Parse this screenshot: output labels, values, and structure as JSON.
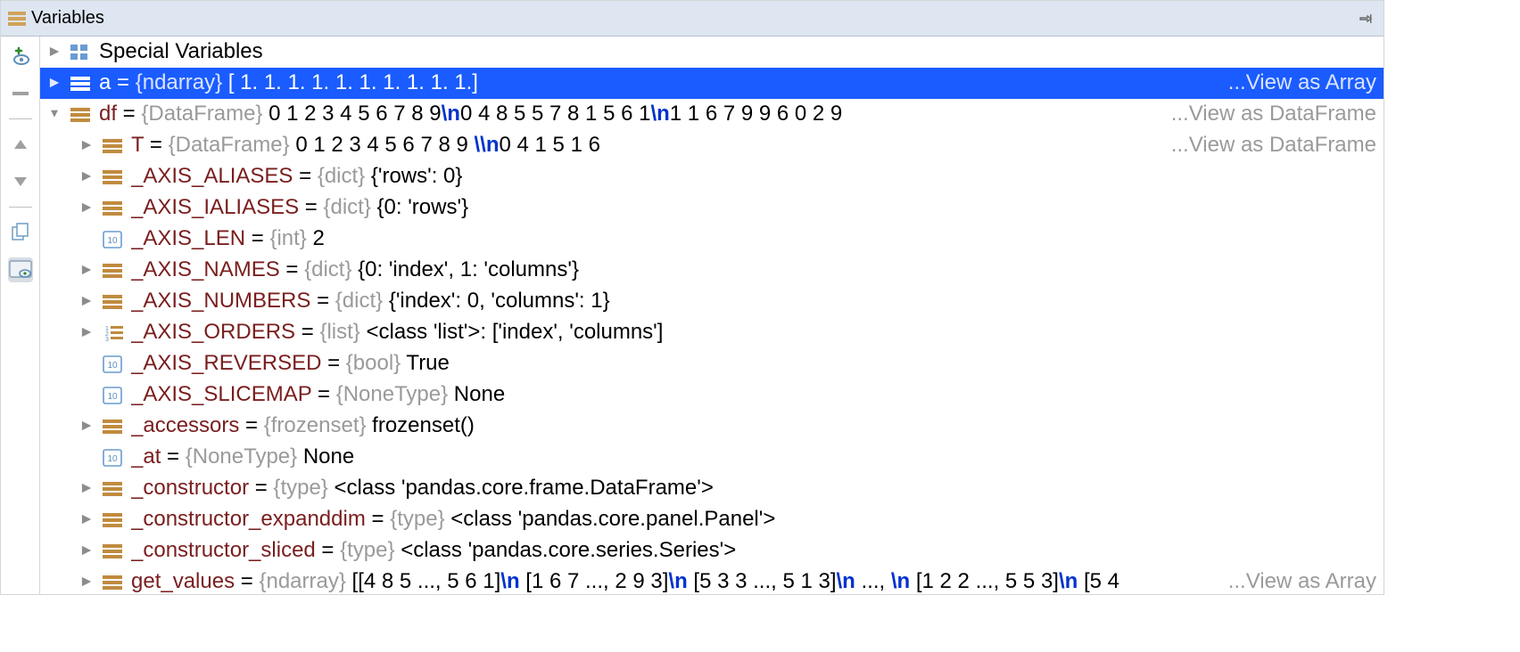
{
  "header": {
    "title": "Variables"
  },
  "colors": {
    "selected_bg": "#1a5cff",
    "name": "#7a1e1e",
    "type": "#9a9a9a",
    "esc": "#0033cc"
  },
  "rows": [
    {
      "indent": 0,
      "chevron": "closed",
      "icon": "grid",
      "name": "Special Variables",
      "eq": "",
      "type": "",
      "val": "",
      "link": ""
    },
    {
      "indent": 0,
      "chevron": "closed",
      "icon": "bars",
      "name": "a",
      "eq": " = ",
      "type": "{ndarray}",
      "val": " [ 1.  1.  1.  1.  1.  1.  1.  1.  1.  1.] ",
      "link": "...View as Array",
      "selected": true
    },
    {
      "indent": 0,
      "chevron": "open",
      "icon": "bars",
      "name": "df",
      "eq": " = ",
      "type": "{DataFrame}",
      "segments": [
        {
          "t": "   0  1  2  3  4  5  6  7  8  9"
        },
        {
          "t": "\\n",
          "esc": true
        },
        {
          "t": "0     4  8  5  5  7  8  1  5  6  1"
        },
        {
          "t": "\\n",
          "esc": true
        },
        {
          "t": "1     1  6  7  9  9  6  0  2  9"
        }
      ],
      "link": "...View as DataFrame"
    },
    {
      "indent": 1,
      "chevron": "closed",
      "icon": "bars",
      "name": "T",
      "eq": " = ",
      "type": "{DataFrame}",
      "segments": [
        {
          "t": "   0     1     2     3     4     5     6     7     8     9     "
        },
        {
          "t": "\\\\n",
          "esc": true
        },
        {
          "t": "0     4     1     5     1     6    "
        }
      ],
      "link": "...View as DataFrame"
    },
    {
      "indent": 1,
      "chevron": "closed",
      "icon": "bars",
      "name": "_AXIS_ALIASES",
      "eq": " = ",
      "type": "{dict}",
      "val": " {'rows': 0}"
    },
    {
      "indent": 1,
      "chevron": "closed",
      "icon": "bars",
      "name": "_AXIS_IALIASES",
      "eq": " = ",
      "type": "{dict}",
      "val": " {0: 'rows'}"
    },
    {
      "indent": 1,
      "chevron": "none",
      "icon": "binary",
      "name": "_AXIS_LEN",
      "eq": " = ",
      "type": "{int}",
      "val": " 2"
    },
    {
      "indent": 1,
      "chevron": "closed",
      "icon": "bars",
      "name": "_AXIS_NAMES",
      "eq": " = ",
      "type": "{dict}",
      "val": " {0: 'index', 1: 'columns'}"
    },
    {
      "indent": 1,
      "chevron": "closed",
      "icon": "bars",
      "name": "_AXIS_NUMBERS",
      "eq": " = ",
      "type": "{dict}",
      "val": " {'index': 0, 'columns': 1}"
    },
    {
      "indent": 1,
      "chevron": "closed",
      "icon": "listnum",
      "name": "_AXIS_ORDERS",
      "eq": " = ",
      "type": "{list}",
      "val": " <class 'list'>: ['index', 'columns']"
    },
    {
      "indent": 1,
      "chevron": "none",
      "icon": "binary",
      "name": "_AXIS_REVERSED",
      "eq": " = ",
      "type": "{bool}",
      "val": " True"
    },
    {
      "indent": 1,
      "chevron": "none",
      "icon": "binary",
      "name": "_AXIS_SLICEMAP",
      "eq": " = ",
      "type": "{NoneType}",
      "val": " None"
    },
    {
      "indent": 1,
      "chevron": "closed",
      "icon": "bars",
      "name": "_accessors",
      "eq": " = ",
      "type": "{frozenset}",
      "val": " frozenset()"
    },
    {
      "indent": 1,
      "chevron": "none",
      "icon": "binary",
      "name": "_at",
      "eq": " = ",
      "type": "{NoneType}",
      "val": " None"
    },
    {
      "indent": 1,
      "chevron": "closed",
      "icon": "bars",
      "name": "_constructor",
      "eq": " = ",
      "type": "{type}",
      "val": " <class 'pandas.core.frame.DataFrame'>"
    },
    {
      "indent": 1,
      "chevron": "closed",
      "icon": "bars",
      "name": "_constructor_expanddim",
      "eq": " = ",
      "type": "{type}",
      "val": " <class 'pandas.core.panel.Panel'>"
    },
    {
      "indent": 1,
      "chevron": "closed",
      "icon": "bars",
      "name": "_constructor_sliced",
      "eq": " = ",
      "type": "{type}",
      "val": " <class 'pandas.core.series.Series'>"
    },
    {
      "indent": 1,
      "chevron": "closed",
      "icon": "bars",
      "name": "get_values",
      "eq": " = ",
      "type": "{ndarray}",
      "segments": [
        {
          "t": " [[4 8 5 ..., 5 6 1]"
        },
        {
          "t": "\\n",
          "esc": true
        },
        {
          "t": " [1 6 7 ..., 2 9 3]"
        },
        {
          "t": "\\n",
          "esc": true
        },
        {
          "t": " [5 3 3 ..., 5 1 3]"
        },
        {
          "t": "\\n",
          "esc": true
        },
        {
          "t": " ..., "
        },
        {
          "t": "\\n",
          "esc": true
        },
        {
          "t": " [1 2 2 ..., 5 5 3]"
        },
        {
          "t": "\\n",
          "esc": true
        },
        {
          "t": " [5 4"
        }
      ],
      "link": "...View as Array"
    }
  ]
}
